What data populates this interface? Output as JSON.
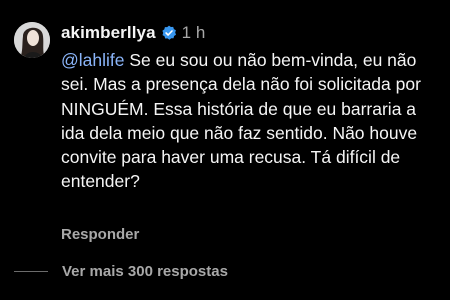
{
  "comment": {
    "username": "akimberllya",
    "verified": true,
    "time": "1 h",
    "mention": "@lahlife",
    "text": " Se eu sou ou não bem-vinda, eu não sei. Mas a presença dela não foi solicitada por NINGUÉM. Essa história de que eu barraria a ida dela meio que não faz sentido. Não houve convite para haver uma recusa. Tá difícil de entender?",
    "reply_label": "Responder",
    "view_more_label": "Ver mais 300 respostas"
  },
  "icons": {
    "avatar": "profile-photo",
    "badge": "verified-badge-icon"
  },
  "colors": {
    "background": "#000000",
    "text": "#f5f5f5",
    "muted": "#a8a8a8",
    "mention": "#8ab4f8",
    "verified": "#3897f0"
  }
}
